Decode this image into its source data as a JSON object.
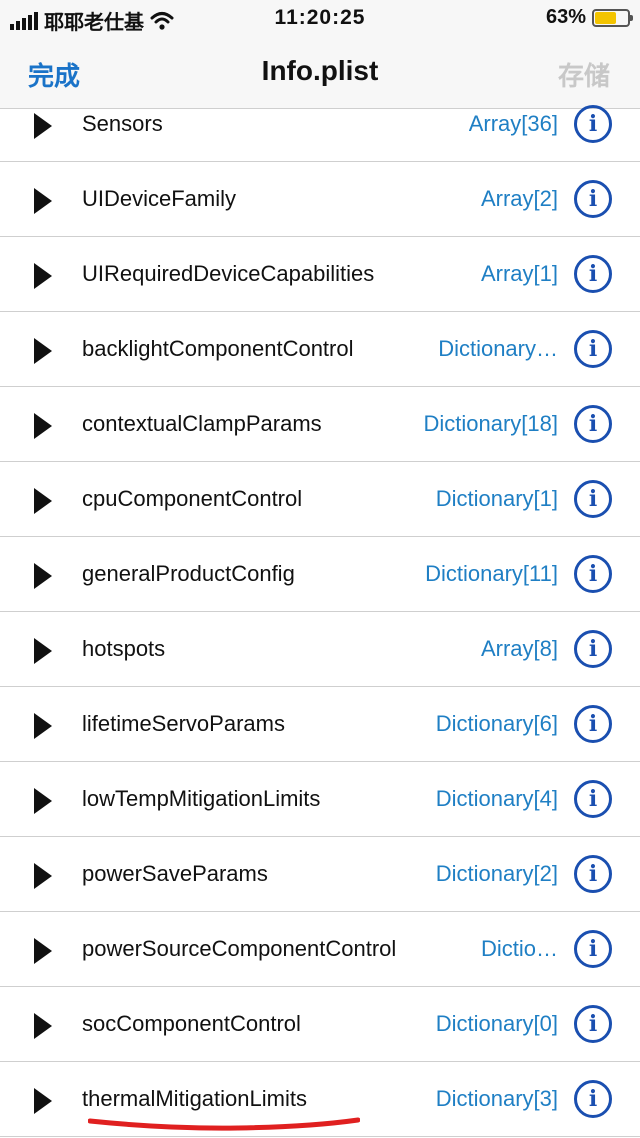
{
  "status_bar": {
    "carrier": "耶耶老仕基",
    "time": "11:20:25",
    "battery_percent": "63%",
    "battery_level": 0.63
  },
  "nav": {
    "done_label": "完成",
    "title": "Info.plist",
    "save_label": "存储"
  },
  "rows": [
    {
      "key": "Sensors",
      "value": "Array[36]"
    },
    {
      "key": "UIDeviceFamily",
      "value": "Array[2]"
    },
    {
      "key": "UIRequiredDeviceCapabilities",
      "value": "Array[1]"
    },
    {
      "key": "backlightComponentControl",
      "value": "Dictionary…"
    },
    {
      "key": "contextualClampParams",
      "value": "Dictionary[18]"
    },
    {
      "key": "cpuComponentControl",
      "value": "Dictionary[1]"
    },
    {
      "key": "generalProductConfig",
      "value": "Dictionary[11]"
    },
    {
      "key": "hotspots",
      "value": "Array[8]"
    },
    {
      "key": "lifetimeServoParams",
      "value": "Dictionary[6]"
    },
    {
      "key": "lowTempMitigationLimits",
      "value": "Dictionary[4]"
    },
    {
      "key": "powerSaveParams",
      "value": "Dictionary[2]"
    },
    {
      "key": "powerSourceComponentControl",
      "value": "Dictio…"
    },
    {
      "key": "socComponentControl",
      "value": "Dictionary[0]"
    },
    {
      "key": "thermalMitigationLimits",
      "value": "Dictionary[3]"
    }
  ],
  "info_glyph": "i",
  "colors": {
    "accent": "#1a73c8",
    "value_text": "#1f7fc4",
    "info_icon": "#1a4fb0",
    "annotation": "#e02020",
    "battery": "#f3c400"
  }
}
